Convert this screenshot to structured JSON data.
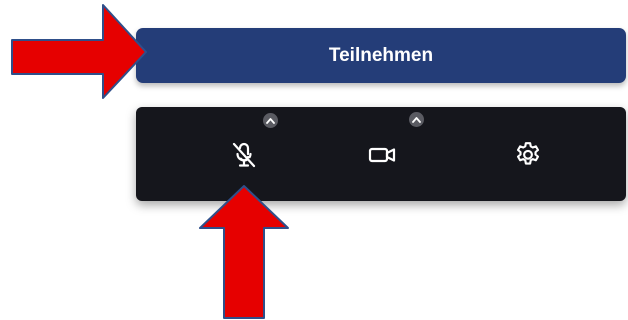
{
  "join_button": {
    "label": "Teilnehmen",
    "color": "#243d78",
    "text_color": "#ffffff"
  },
  "control_bar": {
    "background": "#15161c",
    "controls": [
      {
        "icon": "microphone-muted-icon",
        "state": "muted",
        "has_options_chevron": true
      },
      {
        "icon": "video-camera-icon",
        "state": "on",
        "has_options_chevron": true
      },
      {
        "icon": "settings-gear-icon",
        "has_options_chevron": false
      }
    ]
  },
  "annotations": {
    "arrow_color": "#e60000",
    "arrow_outline": "#2f4f8a",
    "arrows": [
      {
        "points_to": "join-button",
        "direction": "right"
      },
      {
        "points_to": "microphone-toggle",
        "direction": "up"
      }
    ]
  }
}
